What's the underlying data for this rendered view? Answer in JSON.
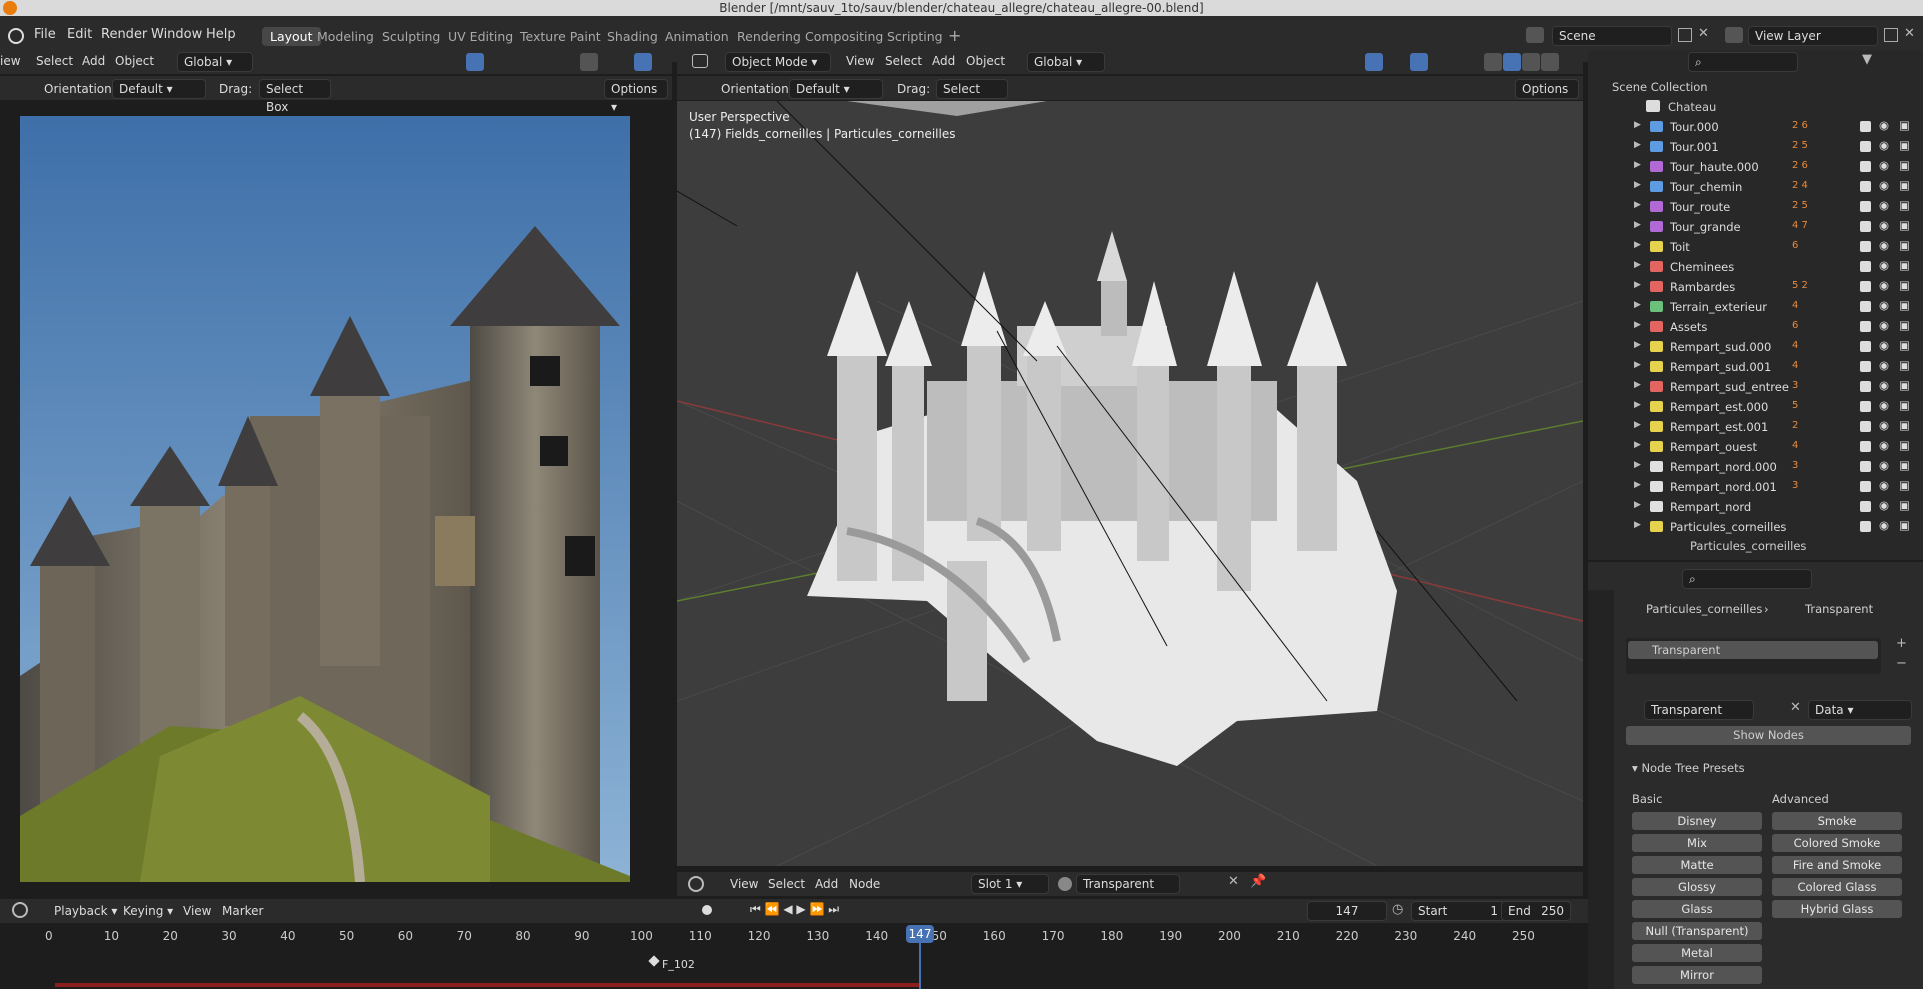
{
  "window": {
    "title": "Blender [/mnt/sauv_1to/sauv/blender/chateau_allegre/chateau_allegre-00.blend]"
  },
  "menu": [
    "File",
    "Edit",
    "Render",
    "Window",
    "Help"
  ],
  "workspaces": [
    "Layout",
    "Modeling",
    "Sculpting",
    "UV Editing",
    "Texture Paint",
    "Shading",
    "Animation",
    "Rendering",
    "Compositing",
    "Scripting"
  ],
  "active_workspace": "Layout",
  "scene": {
    "name": "Scene",
    "view_layer": "View Layer"
  },
  "left_editor": {
    "menu": [
      "iew",
      "Select",
      "Add",
      "Object"
    ],
    "transform": "Global",
    "orientation_label": "Orientation:",
    "orientation_value": "Default",
    "drag_label": "Drag:",
    "drag_value": "Select Box",
    "options": "Options"
  },
  "viewport": {
    "mode": "Object Mode",
    "menu": [
      "View",
      "Select",
      "Add",
      "Object"
    ],
    "transform": "Global",
    "orientation_label": "Orientation:",
    "orientation_value": "Default",
    "drag_label": "Drag:",
    "drag_value": "Select Box",
    "options": "Options",
    "overlay_line1": "User Perspective",
    "overlay_line2": "(147) Fields_corneilles | Particules_corneilles"
  },
  "node_header": {
    "menu": [
      "View",
      "Select",
      "Add",
      "Node"
    ],
    "slot": "Slot 1",
    "material": "Transparent"
  },
  "outliner": {
    "root": "Scene Collection",
    "collection": "Chateau",
    "items": [
      {
        "name": "Tour.000",
        "badge": "2 6",
        "color": "#5d9be3"
      },
      {
        "name": "Tour.001",
        "badge": "2 5",
        "color": "#5d9be3"
      },
      {
        "name": "Tour_haute.000",
        "badge": "2 6",
        "color": "#b169d6"
      },
      {
        "name": "Tour_chemin",
        "badge": "2 4",
        "color": "#5d9be3"
      },
      {
        "name": "Tour_route",
        "badge": "2 5",
        "color": "#b169d6"
      },
      {
        "name": "Tour_grande",
        "badge": "4 7",
        "color": "#b169d6"
      },
      {
        "name": "Toit",
        "badge": "6",
        "color": "#e7d24e"
      },
      {
        "name": "Cheminees",
        "badge": "",
        "color": "#e46460"
      },
      {
        "name": "Rambardes",
        "badge": "5 2",
        "color": "#e46460"
      },
      {
        "name": "Terrain_exterieur",
        "badge": "4",
        "color": "#6bc17b"
      },
      {
        "name": "Assets",
        "badge": "6",
        "color": "#e46460"
      },
      {
        "name": "Rempart_sud.000",
        "badge": "4",
        "color": "#e7d24e"
      },
      {
        "name": "Rempart_sud.001",
        "badge": "4",
        "color": "#e7d24e"
      },
      {
        "name": "Rempart_sud_entree",
        "badge": "3",
        "color": "#e46460"
      },
      {
        "name": "Rempart_est.000",
        "badge": "5",
        "color": "#e7d24e"
      },
      {
        "name": "Rempart_est.001",
        "badge": "2",
        "color": "#e7d24e"
      },
      {
        "name": "Rempart_ouest",
        "badge": "4",
        "color": "#e7d24e"
      },
      {
        "name": "Rempart_nord.000",
        "badge": "3",
        "color": "#e0e0e0"
      },
      {
        "name": "Rempart_nord.001",
        "badge": "3",
        "color": "#e0e0e0"
      },
      {
        "name": "Rempart_nord",
        "badge": "",
        "color": "#e0e0e0"
      },
      {
        "name": "Particules_corneilles",
        "badge": "",
        "color": "#e7d24e"
      }
    ],
    "child": "Particules_corneilles"
  },
  "properties": {
    "breadcrumb_object": "Particules_corneilles",
    "breadcrumb_material": "Transparent",
    "slot_item": "Transparent",
    "material_name": "Transparent",
    "link": "Data",
    "show_nodes": "Show Nodes",
    "presets_title": "Node Tree Presets",
    "basic_label": "Basic",
    "advanced_label": "Advanced",
    "basic": [
      "Disney",
      "Mix",
      "Matte",
      "Glossy",
      "Glass",
      "Null (Transparent)",
      "Metal",
      "Mirror"
    ],
    "advanced": [
      "Smoke",
      "Colored Smoke",
      "Fire and Smoke",
      "Colored Glass",
      "Hybrid Glass"
    ]
  },
  "timeline": {
    "menu": [
      "Playback",
      "Keying",
      "View",
      "Marker"
    ],
    "current_frame": "147",
    "start_label": "Start",
    "start": "1",
    "end_label": "End",
    "end": "250",
    "ticks": [
      "0",
      "10",
      "20",
      "30",
      "40",
      "50",
      "60",
      "70",
      "80",
      "90",
      "100",
      "110",
      "120",
      "130",
      "140",
      "150",
      "160",
      "170",
      "180",
      "190",
      "200",
      "210",
      "220",
      "230",
      "240",
      "250"
    ],
    "playhead": "147",
    "marker": "F_102"
  },
  "colors": {
    "accent": "#4772b3",
    "bg": "#1d1d1d",
    "header": "#2b2b2b"
  }
}
